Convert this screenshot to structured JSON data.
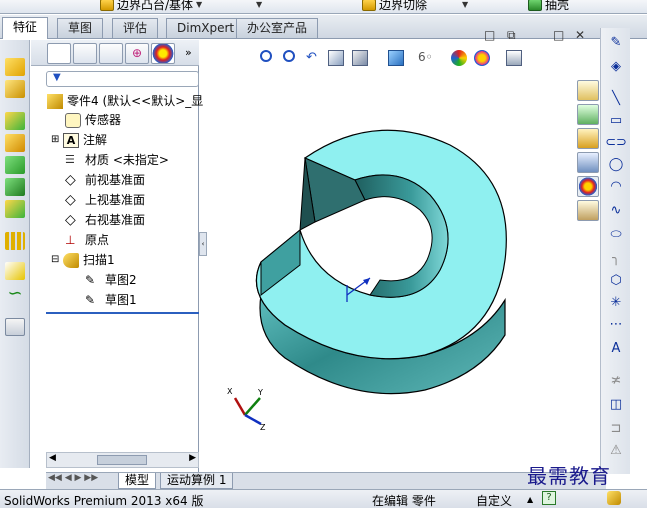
{
  "top_strip": {
    "items": [
      "边界凸台/基体",
      "边界切除",
      "抽壳"
    ]
  },
  "tabs": [
    {
      "label": "特征",
      "active": true
    },
    {
      "label": "草图",
      "active": false
    },
    {
      "label": "评估",
      "active": false
    },
    {
      "label": "DimXpert",
      "active": false
    },
    {
      "label": "办公室产品",
      "active": false
    }
  ],
  "feature_tree": {
    "root": "零件4 (默认<<默认>_显",
    "items": [
      "传感器",
      "注解",
      "材质 <未指定>",
      "前视基准面",
      "上视基准面",
      "右视基准面",
      "原点",
      "扫描1",
      "草图2",
      "草图1"
    ]
  },
  "bottom_tabs": [
    "模型",
    "运动算例 1"
  ],
  "status_bar": {
    "app": "SolidWorks Premium 2013 x64 版",
    "mode": "在编辑 零件",
    "units": "自定义"
  },
  "triad_labels": {
    "x": "X",
    "y": "Y",
    "z": "Z"
  },
  "watermark": "最需教育",
  "window_buttons": [
    "□",
    "⧉",
    "□",
    "✕"
  ],
  "colors": {
    "model_face": "#8ff0f0",
    "model_shade": "#2f8a8a",
    "accent_blue": "#0b2f9a"
  }
}
